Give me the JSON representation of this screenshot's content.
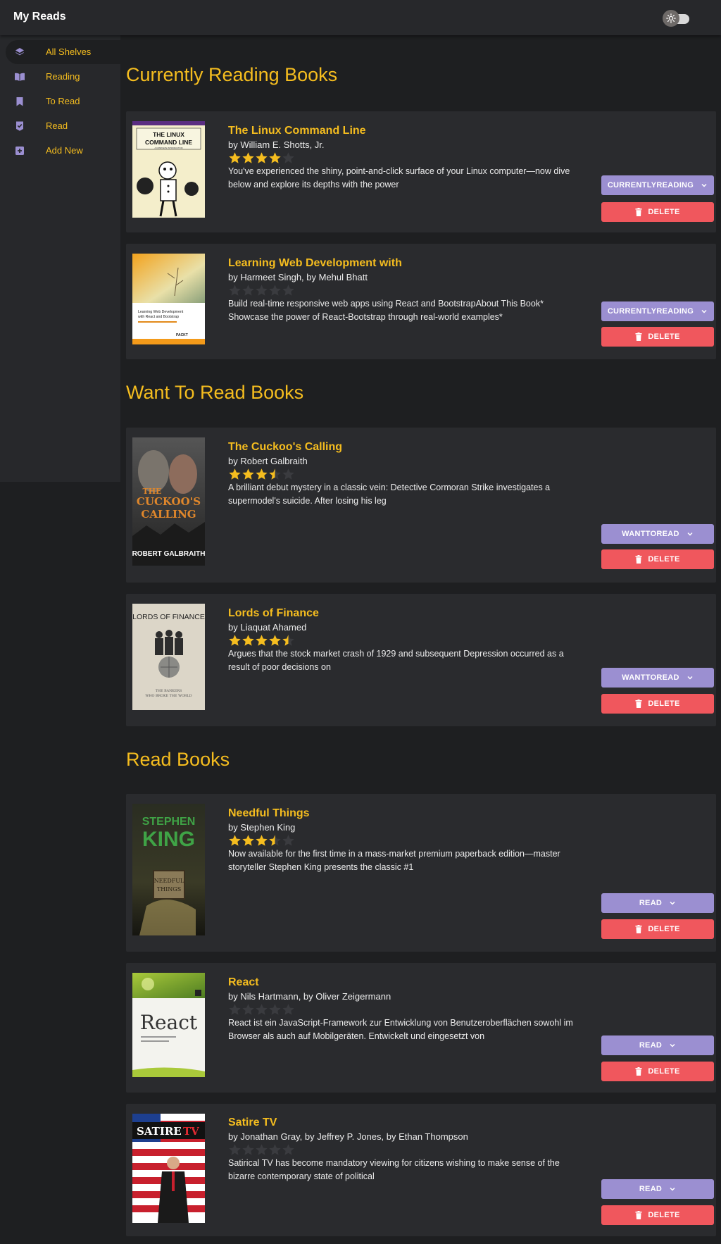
{
  "app": {
    "title": "My Reads"
  },
  "header": {
    "theme_toggle_icon": "sun-icon"
  },
  "sidebar": {
    "items": [
      {
        "label": "All Shelves",
        "icon": "layers-icon",
        "active": true
      },
      {
        "label": "Reading",
        "icon": "open-book-icon",
        "active": false
      },
      {
        "label": "To Read",
        "icon": "bookmark-icon",
        "active": false
      },
      {
        "label": "Read",
        "icon": "check-badge-icon",
        "active": false
      },
      {
        "label": "Add New",
        "icon": "add-box-icon",
        "active": false
      }
    ]
  },
  "colors": {
    "accent": "#f5bd1f",
    "shelf_button": "#9b8fd1",
    "delete_button": "#f0575d",
    "background": "#1e1f21",
    "card": "#2a2b2e"
  },
  "sections": [
    {
      "heading": "Currently Reading Books",
      "books": [
        {
          "title": "The Linux Command Line",
          "authors": "by William E. Shotts, Jr.",
          "rating": 4,
          "description": "You've experienced the shiny, point-and-click surface of your Linux computer—now dive below and explore its depths with the power",
          "shelf_label": "CURRENTLYREADING",
          "delete_label": "DELETE",
          "cover_text": [
            "THE LINUX",
            "COMMAND LINE",
            "A COMPLETE INTRODUCTION"
          ]
        },
        {
          "title": "Learning Web Development with",
          "authors": "by Harmeet Singh, by Mehul Bhatt",
          "rating": 0,
          "description": "Build real-time responsive web apps using React and BootstrapAbout This Book* Showcase the power of React-Bootstrap through real-world examples*",
          "shelf_label": "CURRENTLYREADING",
          "delete_label": "DELETE",
          "cover_text": [
            "Learning Web Development",
            "with React and Bootstrap",
            "PACKT"
          ]
        }
      ]
    },
    {
      "heading": "Want To Read Books",
      "books": [
        {
          "title": "The Cuckoo's Calling",
          "authors": "by Robert Galbraith",
          "rating": 3.5,
          "description": "A brilliant debut mystery in a classic vein: Detective Cormoran Strike investigates a supermodel's suicide. After losing his leg",
          "shelf_label": "WANTTOREAD",
          "delete_label": "DELETE",
          "cover_text": [
            "THE",
            "CUCKOO'S",
            "CALLING",
            "ROBERT GALBRAITH"
          ]
        },
        {
          "title": "Lords of Finance",
          "authors": "by Liaquat Ahamed",
          "rating": 4.5,
          "description": "Argues that the stock market crash of 1929 and subsequent Depression occurred as a result of poor decisions on",
          "shelf_label": "WANTTOREAD",
          "delete_label": "DELETE",
          "cover_text": [
            "LORDS OF FINANCE",
            "THE BANKERS",
            "WHO BROKE THE WORLD"
          ]
        }
      ]
    },
    {
      "heading": "Read Books",
      "books": [
        {
          "title": "Needful Things",
          "authors": "by Stephen King",
          "rating": 3.5,
          "description": "Now available for the first time in a mass-market premium paperback edition—master storyteller Stephen King presents the classic #1",
          "shelf_label": "READ",
          "delete_label": "DELETE",
          "cover_text": [
            "STEPHEN",
            "KING",
            "NEEDFUL",
            "THINGS"
          ]
        },
        {
          "title": "React",
          "authors": "by Nils Hartmann, by Oliver Zeigermann",
          "rating": 0,
          "description": "React ist ein JavaScript-Framework zur Entwicklung von Benutzeroberflächen sowohl im Browser als auch auf Mobilgeräten. Entwickelt und eingesetzt von",
          "shelf_label": "READ",
          "delete_label": "DELETE",
          "cover_text": [
            "React"
          ]
        },
        {
          "title": "Satire TV",
          "authors": "by Jonathan Gray, by Jeffrey P. Jones, by Ethan Thompson",
          "rating": 0,
          "description": "Satirical TV has become mandatory viewing for citizens wishing to make sense of the bizarre contemporary state of political",
          "shelf_label": "READ",
          "delete_label": "DELETE",
          "cover_text": [
            "SATIRE",
            "TV"
          ]
        }
      ]
    }
  ]
}
